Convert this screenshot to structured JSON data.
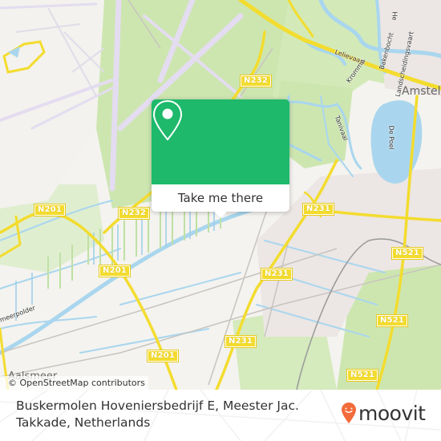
{
  "map": {
    "road_labels": [
      "N232",
      "N232",
      "N201",
      "N201",
      "N201",
      "N231",
      "N231",
      "N231",
      "N521",
      "N521",
      "N521"
    ],
    "place_labels": {
      "amstelveen": "Amstelv",
      "aalsmeer": "Aalsmeer"
    },
    "street_labels": {
      "kromme": "Kromme",
      "lelievaart": "Lelievaart",
      "bakenbocht": "Bakenbocht",
      "landscheidingsvaart": "Landscheidingsvaart",
      "tanivaal": "Tanivaal",
      "depoel": "De Poel",
      "meerpolder": "meerpolder",
      "he": "He"
    },
    "attribution": "© OpenStreetMap contributors",
    "colors": {
      "land": "#f4f3ef",
      "green": "#cde6b0",
      "water": "#a9d6ee",
      "road": "#f3dc2e",
      "runway": "#e4dcf0",
      "urban": "#ece6e4"
    }
  },
  "popup": {
    "icon": "map-pin-icon",
    "button_label": "Take me there",
    "color": "#1eb96b"
  },
  "footer": {
    "address_line1": "Buskermolen Hoveniersbedrijf E, Meester Jac.",
    "address_line2": "Takkade, Netherlands",
    "brand": "moovit",
    "brand_color": "#f26b3a"
  }
}
